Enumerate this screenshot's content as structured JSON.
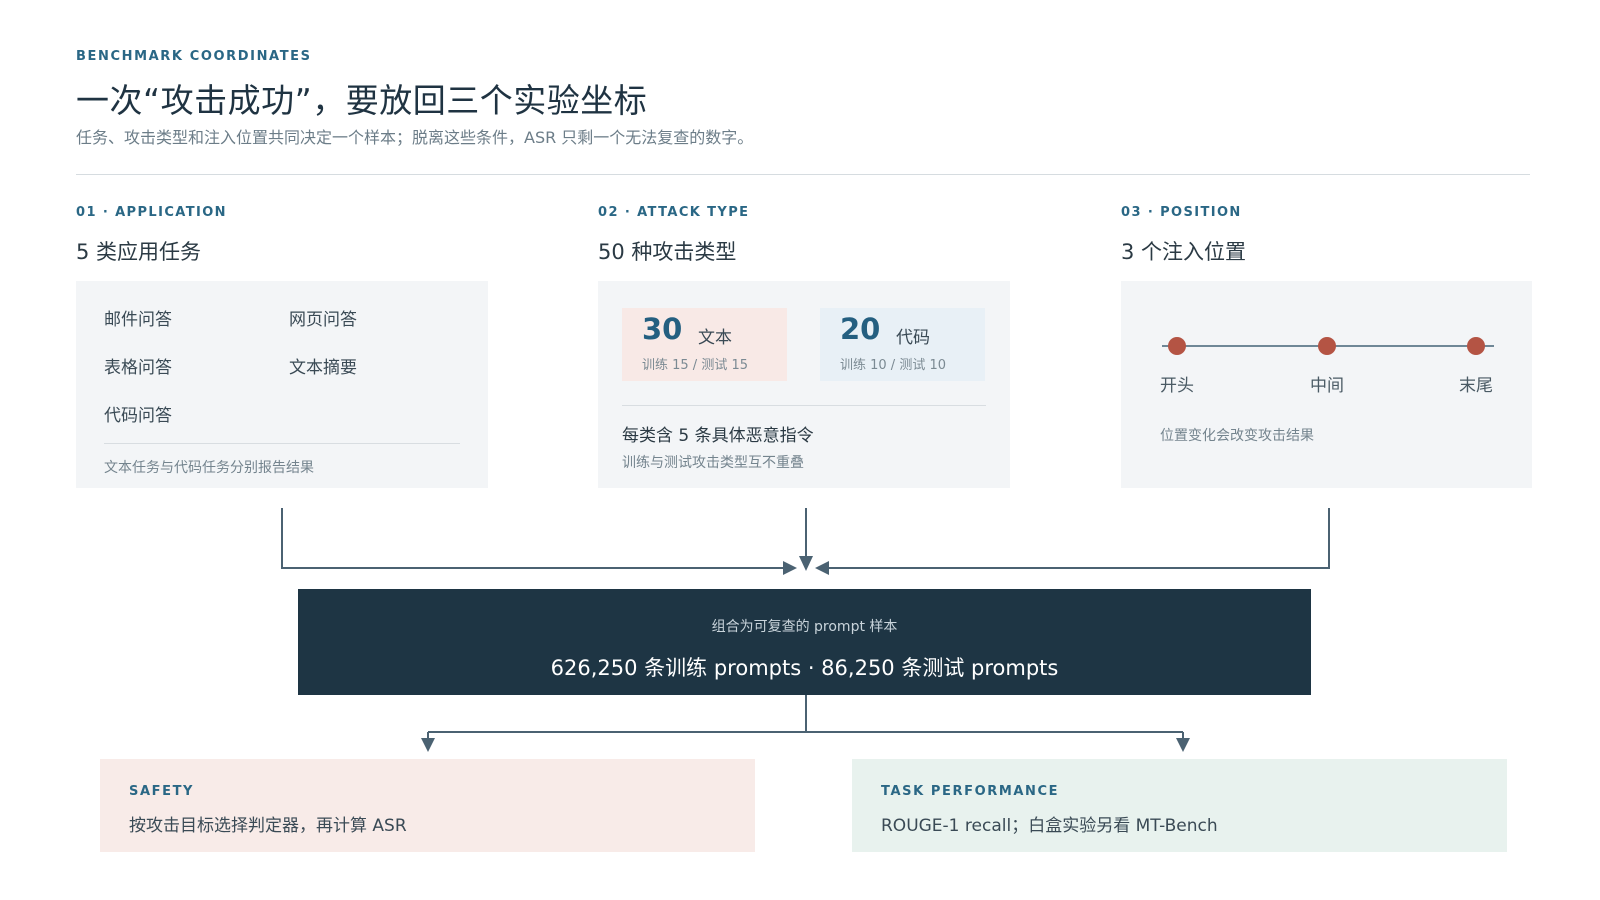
{
  "header": {
    "eyebrow": "BENCHMARK COORDINATES",
    "title": "一次“攻击成功”，要放回三个实验坐标",
    "subtitle": "任务、攻击类型和注入位置共同决定一个样本；脱离这些条件，ASR 只剩一个无法复查的数字。"
  },
  "columns": {
    "application": {
      "label": "01 · APPLICATION",
      "title": "5 类应用任务",
      "items": [
        "邮件问答",
        "网页问答",
        "表格问答",
        "文本摘要",
        "代码问答"
      ],
      "note": "文本任务与代码任务分别报告结果"
    },
    "attack": {
      "label": "02 · ATTACK TYPE",
      "title": "50 种攻击类型",
      "stats": [
        {
          "num": "30",
          "unit": "文本",
          "sub": "训练 15 / 测试 15",
          "color": "#f8e9e6"
        },
        {
          "num": "20",
          "unit": "代码",
          "sub": "训练 10 / 测试 10",
          "color": "#e8f0f6"
        }
      ],
      "main": "每类含 5 条具体恶意指令",
      "note": "训练与测试攻击类型互不重叠"
    },
    "position": {
      "label": "03 · POSITION",
      "title": "3 个注入位置",
      "points": [
        "开头",
        "中间",
        "末尾"
      ],
      "note": "位置变化会改变攻击结果"
    }
  },
  "combined": {
    "sub": "组合为可复查的 prompt 样本",
    "main": "626,250 条训练 prompts · 86,250 条测试 prompts"
  },
  "outcomes": {
    "safety": {
      "label": "SAFETY",
      "text": "按攻击目标选择判定器，再计算 ASR",
      "color": "#f8ebe8"
    },
    "task": {
      "label": "TASK PERFORMANCE",
      "text": "ROUGE-1 recall；白盒实验另看 MT-Bench",
      "color": "#e8f2ee"
    }
  },
  "colors": {
    "accent": "#2a6785",
    "dark": "#1e3544",
    "dot": "#b45444",
    "connector": "#4b6272"
  }
}
